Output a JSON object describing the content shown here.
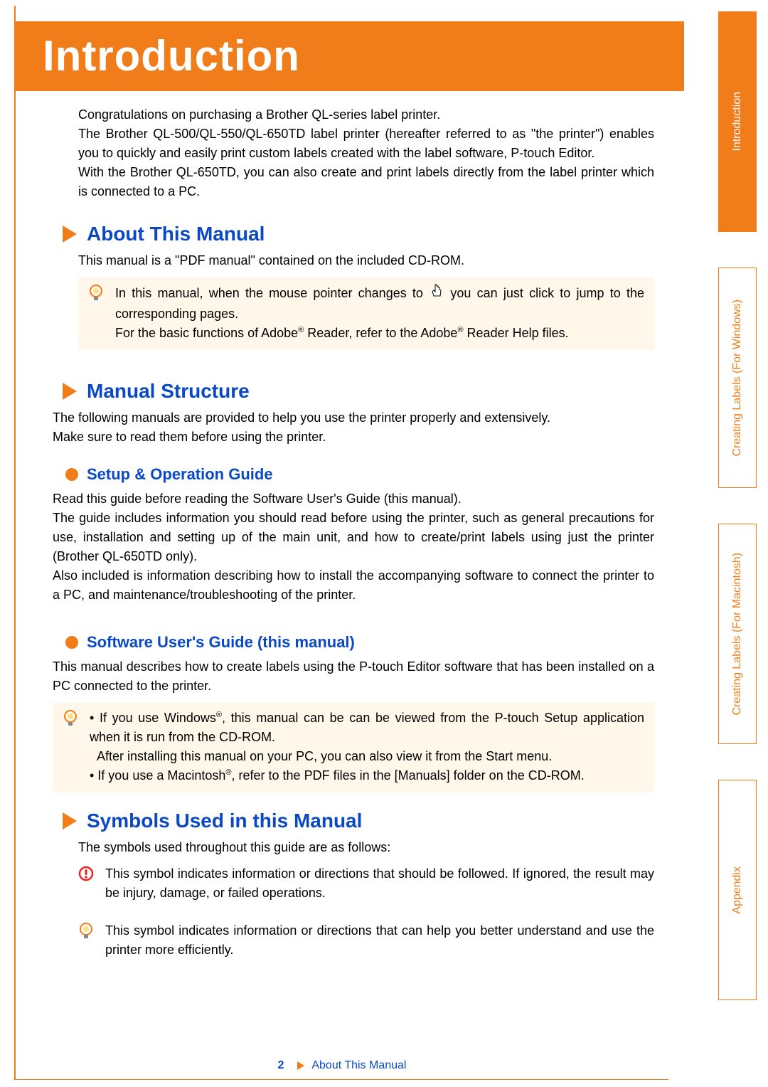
{
  "banner": {
    "title": "Introduction"
  },
  "intro": {
    "p1": "Congratulations on purchasing a Brother QL-series label printer.",
    "p2": "The Brother QL-500/QL-550/QL-650TD label printer (hereafter referred to as \"the printer\") enables you to quickly and easily print custom labels created with the label software, P-touch Editor.",
    "p3": "With the Brother QL-650TD, you can also create and print labels directly from the label printer which is connected to a PC."
  },
  "about": {
    "heading": "About This Manual",
    "text": "This manual is a \"PDF manual\" contained on the included CD-ROM.",
    "note_a": "In this manual, when the mouse pointer changes to ",
    "note_b": " you can just click to jump to the corresponding pages.",
    "note2_a": "For the basic functions of Adobe",
    "note2_b": " Reader, refer to the Adobe",
    "note2_c": " Reader Help files."
  },
  "structure": {
    "heading": "Manual Structure",
    "text1": "The following manuals are provided to help you use the printer properly and extensively.",
    "text2": "Make sure to read them before using the printer."
  },
  "setup": {
    "heading": "Setup & Operation Guide",
    "p1": "Read this guide before reading the Software User's Guide (this manual).",
    "p2": "The guide includes information you should read before using the printer, such as general precautions for use, installation and setting up of the main unit, and how to create/print labels using just the printer (Brother QL-650TD only).",
    "p3": "Also included is information describing how to install the accompanying software to connect the printer to a PC, and maintenance/troubleshooting of the printer."
  },
  "software": {
    "heading": "Software User's Guide (this manual)",
    "p1": "This manual describes how to create labels using the P-touch Editor software that has been installed on a PC connected to the printer.",
    "note_b1a": "• If you use Windows",
    "note_b1b": ", this manual can be can be viewed from the P-touch Setup application when it is run from the CD-ROM.",
    "note_b2": "After installing this manual on your PC, you can also view it from the Start menu.",
    "note_b3a": "• If you use a Macintosh",
    "note_b3b": ", refer to the PDF files in the [Manuals] folder on the CD-ROM."
  },
  "symbols": {
    "heading": "Symbols Used in this Manual",
    "intro": "The symbols used throughout this guide are as follows:",
    "warn": "This symbol indicates information or directions that should be followed. If ignored, the result may be injury, damage, or failed operations.",
    "tip": "This symbol indicates information or directions that can help you better understand and use the printer more efficiently."
  },
  "footer": {
    "page": "2",
    "link": "About This Manual"
  },
  "tabs": {
    "t1": "Introduction",
    "t2": "Creating Labels (For Windows)",
    "t3": "Creating Labels (For Macintosh)",
    "t4": "Appendix"
  },
  "sup": "®"
}
